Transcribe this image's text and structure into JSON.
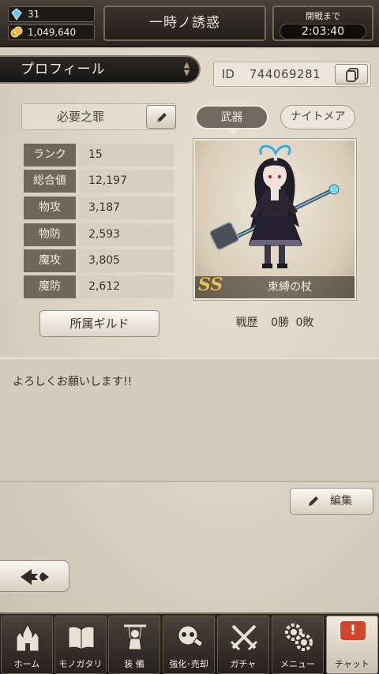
{
  "header": {
    "gems": "31",
    "gold": "1,049,640",
    "title": "一時ノ誘惑",
    "battle_label": "開戦まで",
    "battle_timer": "2:03:40"
  },
  "profile": {
    "tab_label": "プロフィール",
    "id_label": "ID",
    "id_value": "744069281",
    "player_title": "必要之罪",
    "stats": [
      {
        "label": "ランク",
        "value": "15"
      },
      {
        "label": "総合値",
        "value": "12,197"
      },
      {
        "label": "物攻",
        "value": "3,187"
      },
      {
        "label": "物防",
        "value": "2,593"
      },
      {
        "label": "魔攻",
        "value": "3,805"
      },
      {
        "label": "魔防",
        "value": "2,612"
      }
    ],
    "guild_button": "所属ギルド"
  },
  "weapon": {
    "tab_weapon": "武器",
    "tab_nightmare": "ナイトメア",
    "rank": "SS",
    "name": "束縛の杖",
    "record_label": "戦歴",
    "wins": "0勝",
    "losses": "0敗"
  },
  "message": {
    "text": "よろしくお願いします!!",
    "edit_button": "編集"
  },
  "nav": {
    "items": [
      {
        "label": "ホーム",
        "icon": "castle-icon"
      },
      {
        "label": "モノガタリ",
        "icon": "book-icon"
      },
      {
        "label": "装 備",
        "icon": "puppet-icon"
      },
      {
        "label": "強化･売却",
        "icon": "skull-hammer-icon"
      },
      {
        "label": "ガチャ",
        "icon": "crossed-swords-icon"
      },
      {
        "label": "メニュー",
        "icon": "gears-icon"
      },
      {
        "label": "チャット",
        "icon": "chat-icon",
        "badge": "!"
      }
    ]
  },
  "colors": {
    "accent_gold": "#e6c25a",
    "chat_alert": "#d2442b",
    "gem_blue": "#6ec7e8"
  }
}
